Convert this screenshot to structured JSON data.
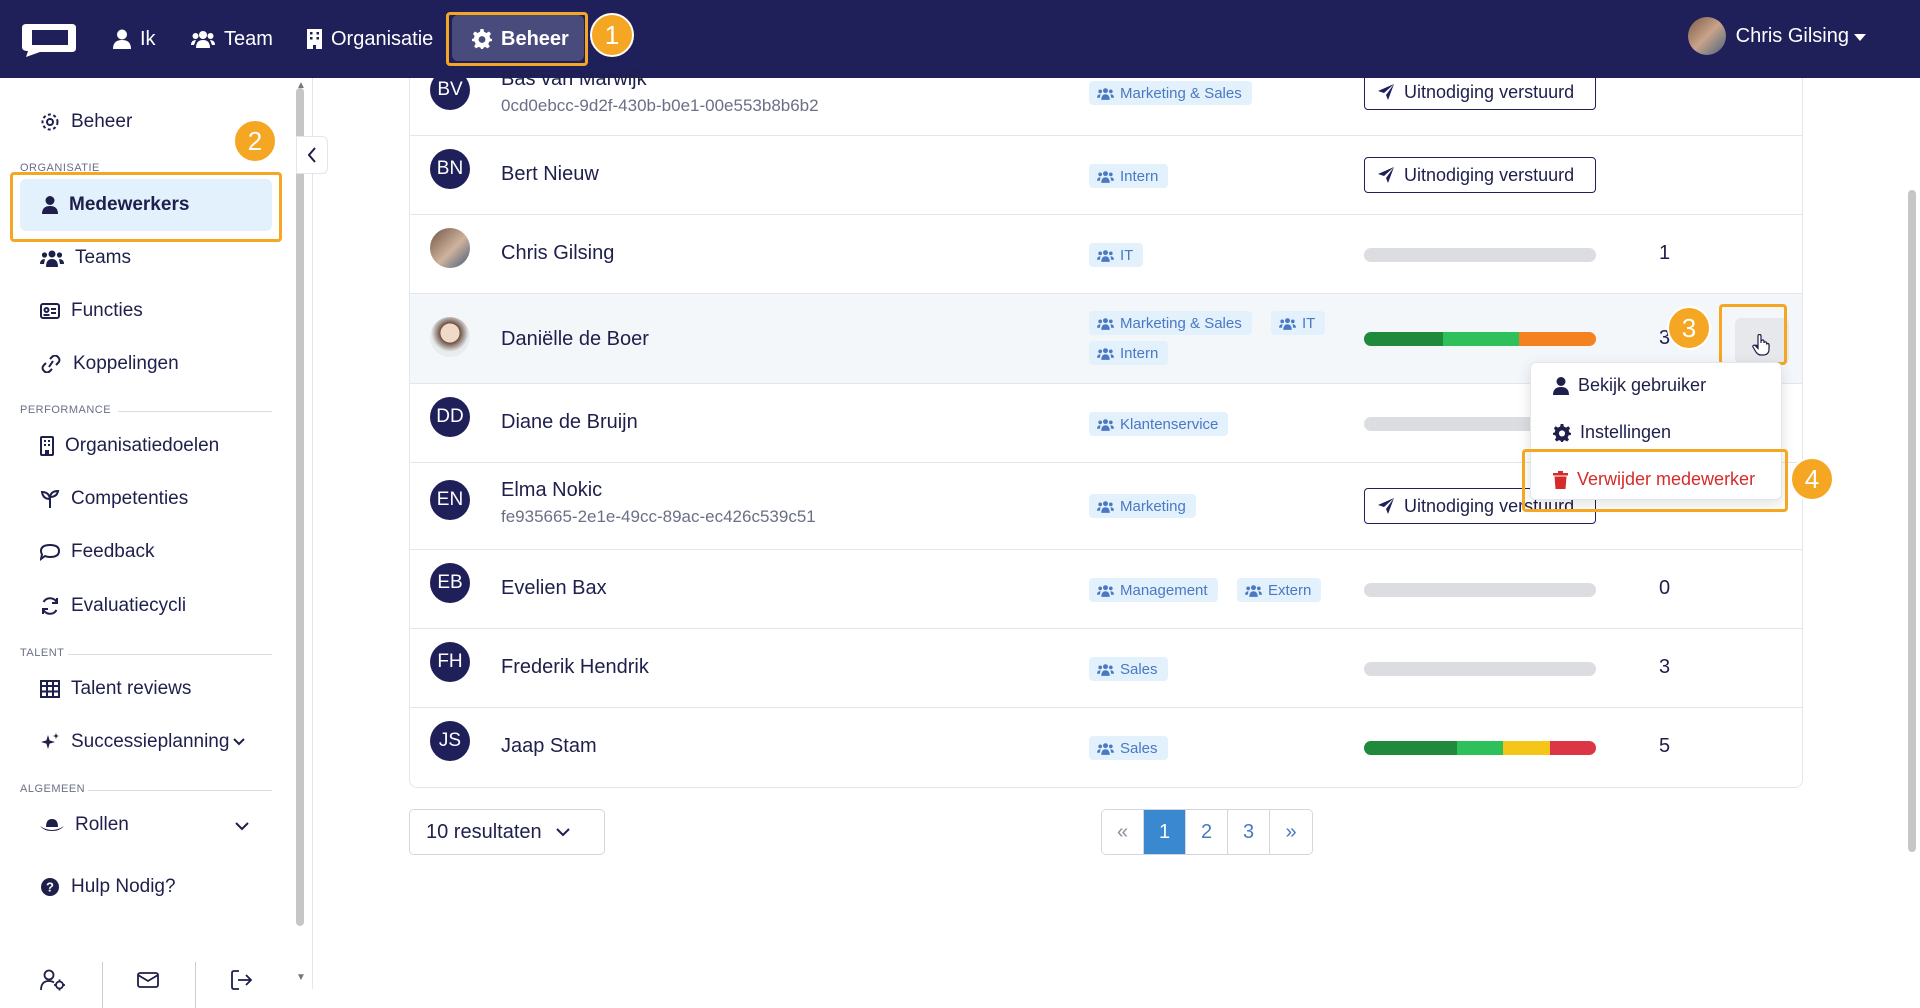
{
  "colors": {
    "navbar": "#1f1f59",
    "accent": "#f5a623",
    "tag_bg": "#e3f1fc",
    "tag_text": "#4a78c3",
    "danger": "#d52b2b",
    "pager_active": "#3a89d0"
  },
  "topnav": {
    "items": [
      {
        "label": "Ik",
        "icon": "user-icon"
      },
      {
        "label": "Team",
        "icon": "users-icon"
      },
      {
        "label": "Organisatie",
        "icon": "building-icon"
      },
      {
        "label": "Beheer",
        "icon": "gear-icon"
      }
    ],
    "user": "Chris Gilsing"
  },
  "callouts": {
    "one": "1",
    "two": "2",
    "three": "3",
    "four": "4"
  },
  "sidebar": {
    "top_item": "Beheer",
    "section_org": "ORGANISATIE",
    "org_items": [
      "Medewerkers",
      "Teams",
      "Functies",
      "Koppelingen"
    ],
    "section_perf": "PERFORMANCE",
    "perf_items": [
      "Organisatiedoelen",
      "Competenties",
      "Feedback",
      "Evaluatiecycli"
    ],
    "section_talent": "TALENT",
    "talent_items": [
      "Talent reviews",
      "Successieplanning"
    ],
    "section_general": "ALGEMEEN",
    "general_items": [
      "Rollen",
      "Hulp Nodig?"
    ]
  },
  "employees": [
    {
      "initials": "BV",
      "name": "Bas van Marwijk",
      "uuid": "0cd0ebcc-9d2f-430b-b0e1-00e553b8b6b2",
      "tags": [
        "Marketing & Sales"
      ],
      "status": "Uitnodiging verstuurd"
    },
    {
      "initials": "BN",
      "name": "Bert Nieuw",
      "tags": [
        "Intern"
      ],
      "status": "Uitnodiging verstuurd"
    },
    {
      "initials": "",
      "name": "Chris Gilsing",
      "tags": [
        "IT"
      ],
      "score": "1"
    },
    {
      "initials": "",
      "name": "Daniëlle de Boer",
      "tags": [
        "Marketing & Sales",
        "IT",
        "Intern"
      ],
      "score": "3",
      "progress": [
        {
          "color": "#1f8a3b",
          "fraction": 0.34
        },
        {
          "color": "#2ec05a",
          "fraction": 0.33
        },
        {
          "color": "#f58220",
          "fraction": 0.33
        }
      ]
    },
    {
      "initials": "DD",
      "name": "Diane de Bruijn",
      "tags": [
        "Klantenservice"
      ]
    },
    {
      "initials": "EN",
      "name": "Elma Nokic",
      "uuid": "fe935665-2e1e-49cc-89ac-ec426c539c51",
      "tags": [
        "Marketing"
      ],
      "status": "Uitnodiging verstuurd"
    },
    {
      "initials": "EB",
      "name": "Evelien Bax",
      "tags": [
        "Management",
        "Extern"
      ],
      "score": "0"
    },
    {
      "initials": "FH",
      "name": "Frederik Hendrik",
      "tags": [
        "Sales"
      ],
      "score": "3"
    },
    {
      "initials": "JS",
      "name": "Jaap Stam",
      "tags": [
        "Sales"
      ],
      "score": "5",
      "progress": [
        {
          "color": "#1f8a3b",
          "fraction": 0.4
        },
        {
          "color": "#2ec05a",
          "fraction": 0.2
        },
        {
          "color": "#f5c518",
          "fraction": 0.2
        },
        {
          "color": "#dc3545",
          "fraction": 0.2
        }
      ]
    }
  ],
  "context_menu": {
    "more": "...",
    "items": [
      "Bekijk gebruiker",
      "Instellingen",
      "Verwijder medewerker"
    ]
  },
  "footer": {
    "results": "10 resultaten",
    "pages": [
      "«",
      "1",
      "2",
      "3",
      "»"
    ]
  }
}
